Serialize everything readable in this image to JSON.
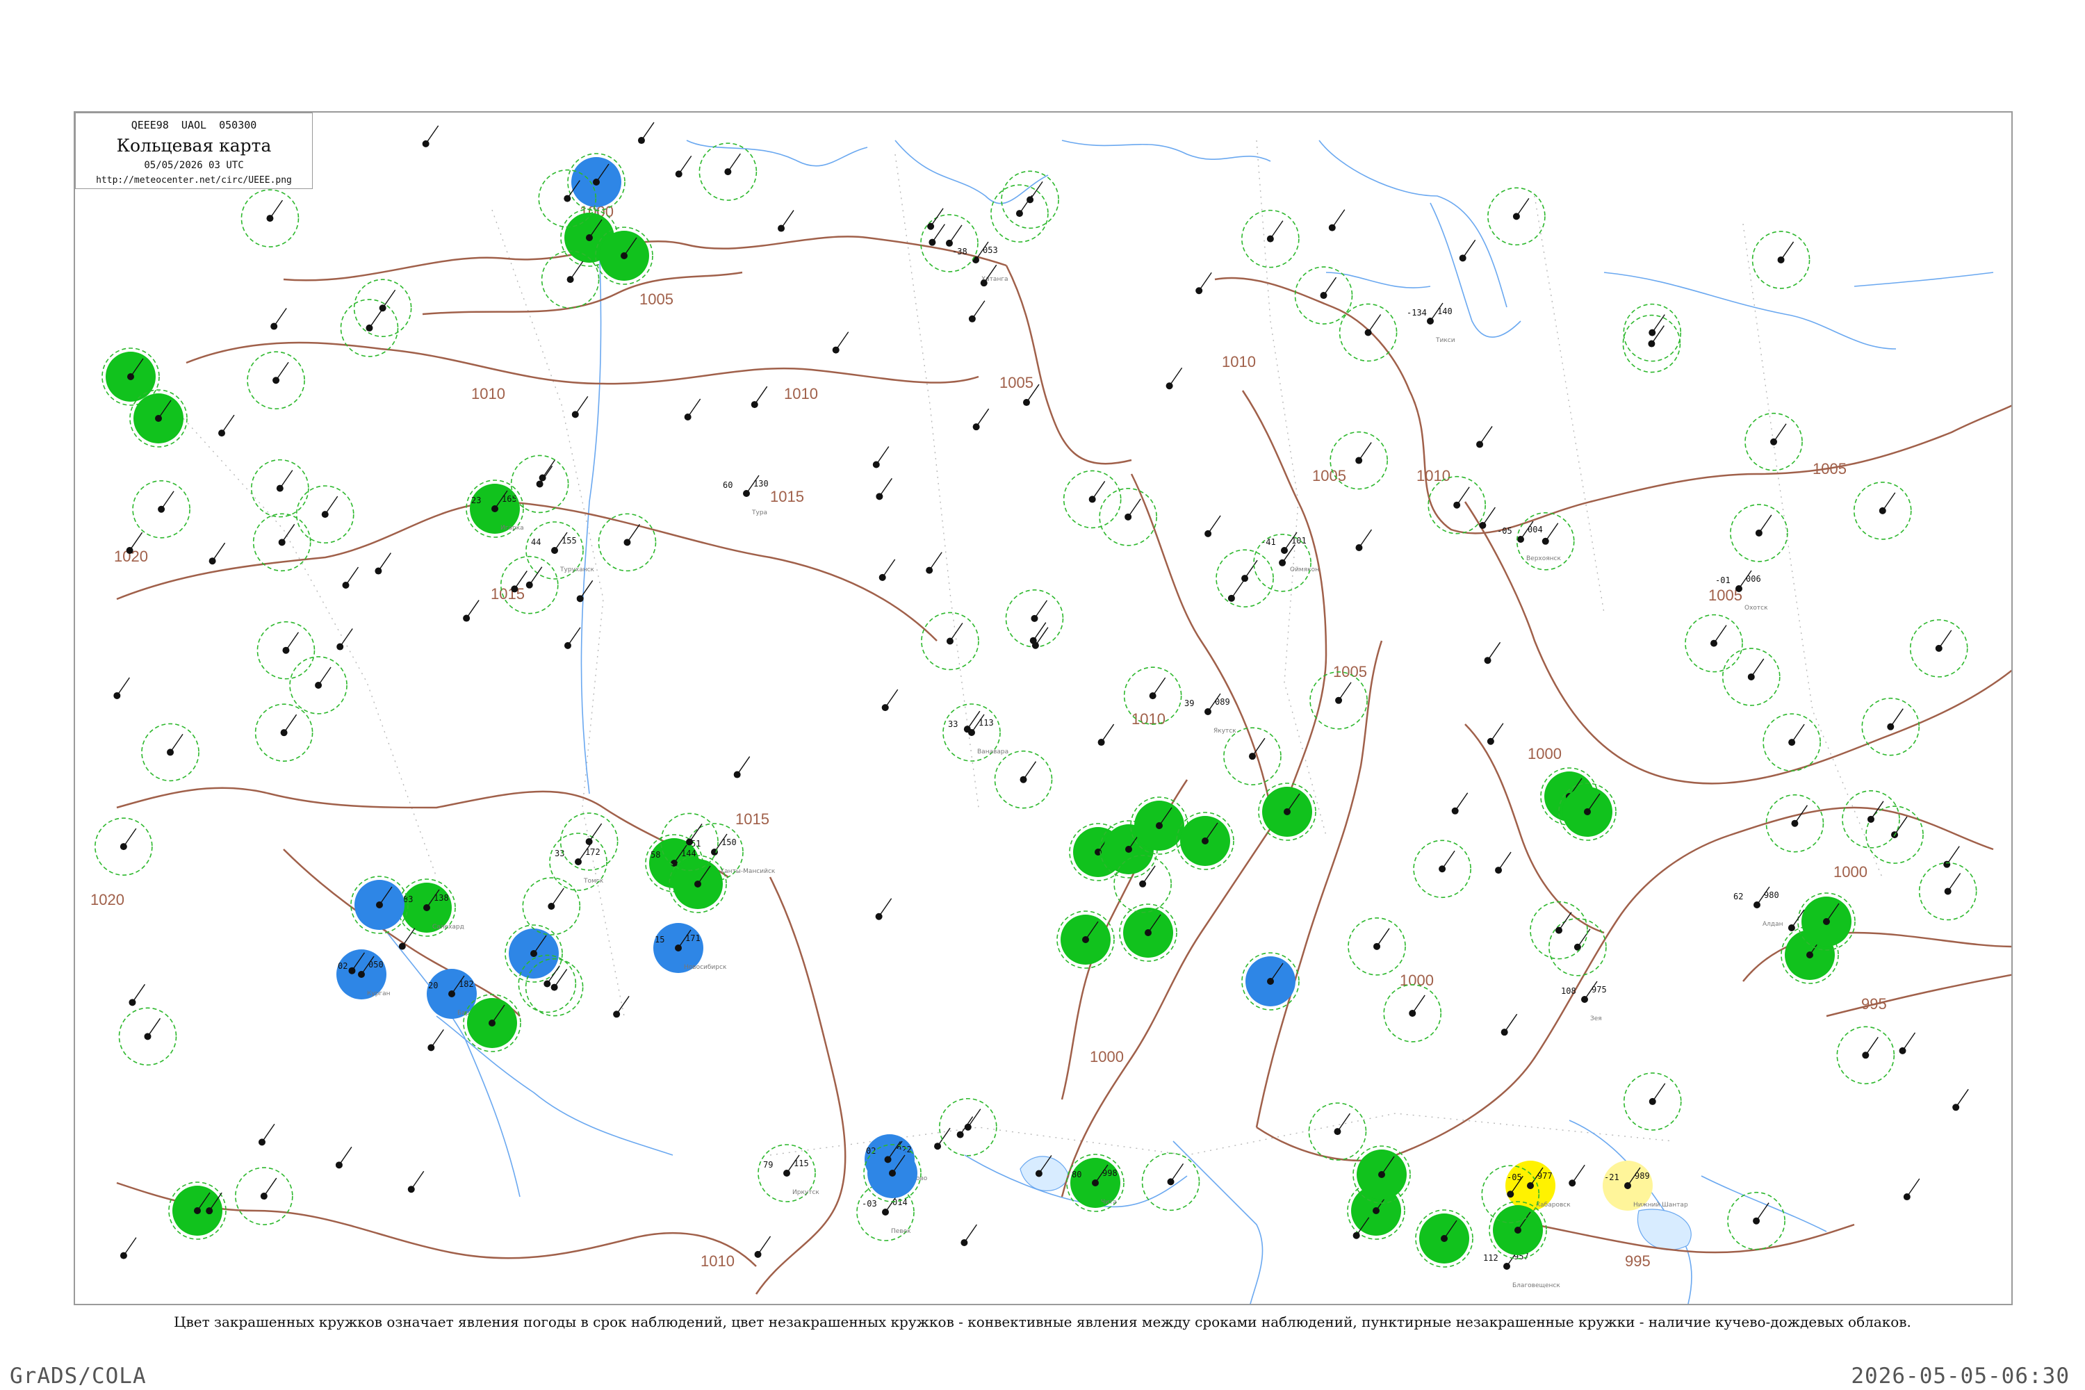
{
  "header": {
    "code": "QEEE98  UAOL  050300",
    "title": "Кольцевая карта",
    "date": "05/05/2026 03 UTC",
    "url": "http://meteocenter.net/circ/UEEE.png"
  },
  "caption": "Цвет закрашенных кружков означает явления погоды в срок наблюдений, цвет незакрашенных кружков - конвективные явления между сроками наблюдений, пунктирные незакрашенные кружки - наличие кучево-дождевых облаков.",
  "footer": {
    "left": "GrADS/COLA",
    "right": "2026-05-05-06:30"
  },
  "colors": {
    "isobar": "#a0604a",
    "river": "#6aa8f0",
    "rain": "#11c21d",
    "snow": "#2e86e6",
    "fog": "#fff200",
    "haze": "#fff59a",
    "cb_ring": "#2db82d"
  },
  "isobar_labels": [
    "1000",
    "1005",
    "1010",
    "1015",
    "1020",
    "1005",
    "1010",
    "1010",
    "1005",
    "1010",
    "1015",
    "1020",
    "1015",
    "1010",
    "1005",
    "1005",
    "1000",
    "1000",
    "995",
    "995",
    "1000",
    "1000",
    "1010",
    "1005"
  ],
  "stations": [
    {
      "name": "Певек",
      "temp": "-03",
      "pressure": "014",
      "kind": "none",
      "cb": true
    },
    {
      "name": "Игарка",
      "temp": "23",
      "pressure": "165",
      "kind": "rain",
      "cb": true
    },
    {
      "name": "Хатанга",
      "temp": "-38",
      "pressure": "053",
      "kind": "none",
      "cb": false
    },
    {
      "name": "Верхоянск",
      "temp": "-05",
      "pressure": "004",
      "kind": "none",
      "cb": false
    },
    {
      "name": "Оймякон",
      "temp": "-41",
      "pressure": "101",
      "kind": "none",
      "cb": false
    },
    {
      "name": "Туруханск",
      "temp": "44",
      "pressure": "155",
      "kind": "none",
      "cb": true
    },
    {
      "name": "Тура",
      "temp": "60",
      "pressure": "130",
      "kind": "none",
      "cb": false
    },
    {
      "name": "Ванавара",
      "temp": "33",
      "pressure": "113",
      "kind": "none",
      "cb": true
    },
    {
      "name": "Якутск",
      "temp": "39",
      "pressure": "089",
      "kind": "none",
      "cb": false
    },
    {
      "name": "Алдан",
      "temp": "62",
      "pressure": "980",
      "kind": "none",
      "cb": false
    },
    {
      "name": "Иркутск",
      "temp": "79",
      "pressure": "115",
      "kind": "none",
      "cb": true
    },
    {
      "name": "Чита",
      "temp": "80",
      "pressure": "998",
      "kind": "rain",
      "cb": true
    },
    {
      "name": "Благовещенск",
      "temp": "112",
      "pressure": "957",
      "kind": "none",
      "cb": false
    },
    {
      "name": "Хабаровск",
      "temp": "-05",
      "pressure": "977",
      "kind": "fog",
      "cb": false
    },
    {
      "name": "Нижний Шантар",
      "temp": "-21",
      "pressure": "989",
      "kind": "haze",
      "cb": false
    },
    {
      "name": "Ханты-Мансийск",
      "temp": "51",
      "pressure": "150",
      "kind": "none",
      "cb": true
    },
    {
      "name": "Томск",
      "temp": "33",
      "pressure": "172",
      "kind": "none",
      "cb": true
    },
    {
      "name": "Новосибирск",
      "temp": "15",
      "pressure": "171",
      "kind": "snow",
      "cb": false
    },
    {
      "name": "Барнаул",
      "temp": "20",
      "pressure": "182",
      "kind": "snow",
      "cb": false
    },
    {
      "name": "Красноярск",
      "temp": "58",
      "pressure": "144",
      "kind": "rain",
      "cb": true
    },
    {
      "name": "Кемерово",
      "temp": "02",
      "pressure": "022",
      "kind": "snow",
      "cb": false
    },
    {
      "name": "Курган",
      "temp": "02",
      "pressure": "050",
      "kind": "snow",
      "cb": false
    },
    {
      "name": "Салехард",
      "temp": "83",
      "pressure": "138",
      "kind": "rain",
      "cb": true
    },
    {
      "name": "Тикси",
      "temp": "-134",
      "pressure": "140",
      "kind": "none",
      "cb": false
    },
    {
      "name": "Охотск",
      "temp": "-01",
      "pressure": "006",
      "kind": "none",
      "cb": false
    },
    {
      "name": "Зея",
      "temp": "108",
      "pressure": "975",
      "kind": "none",
      "cb": false
    }
  ]
}
